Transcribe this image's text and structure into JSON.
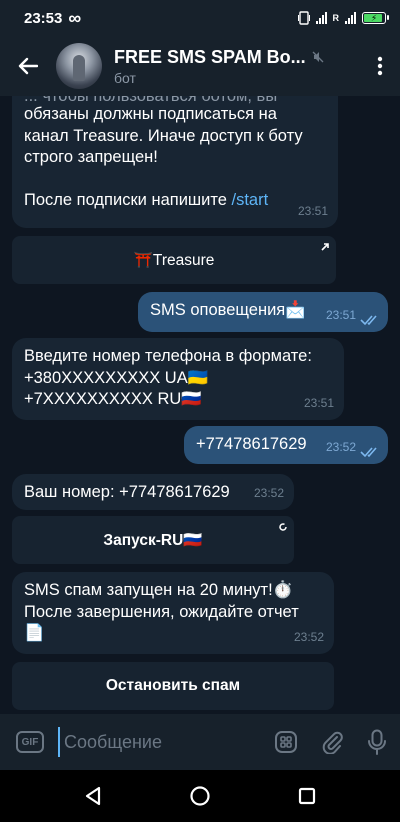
{
  "status": {
    "time": "23:53",
    "infinity": "∞",
    "net_label": "R"
  },
  "header": {
    "title": "FREE SMS SPAM Bo...",
    "subtitle": "бот"
  },
  "messages": [
    {
      "direction": "in",
      "text": "обязаны должны подписаться на канал Treasure. Иначе доступ к боту строго запрещен!",
      "partial_top": "... чтобы пользоваться ботом, вы",
      "text2": "После подписки напишите ",
      "link": "/start",
      "time": "23:51"
    },
    {
      "kind": "inline-button",
      "label": "⛩️Treasure"
    },
    {
      "direction": "out",
      "text": "SMS оповещения📩",
      "time": "23:51"
    },
    {
      "direction": "in",
      "lines": [
        "Введите номер телефона в формате:",
        "+380XXXXXXXXX UA🇺🇦",
        "+7XXXXXXXXXX RU🇷🇺"
      ],
      "time": "23:51"
    },
    {
      "direction": "out",
      "text": "+77478617629",
      "time": "23:52"
    },
    {
      "direction": "in",
      "text": "Ваш номер: +77478617629",
      "time": "23:52"
    },
    {
      "kind": "inline-button",
      "label": "Запуск-RU🇷🇺"
    },
    {
      "direction": "in",
      "lines": [
        "SMS спам запущен на 20 минут!⏱️",
        "После завершения, ожидайте отчет",
        "📄"
      ],
      "time": "23:52"
    },
    {
      "kind": "inline-button",
      "label": "Остановить спам"
    }
  ],
  "input": {
    "placeholder": "Сообщение",
    "gif_label": "GIF"
  },
  "colors": {
    "background": "#0e1621",
    "header": "#17212b",
    "incoming": "#182533",
    "outgoing": "#2b5278",
    "link": "#5eb5f7"
  },
  "icons": [
    "back-arrow-icon",
    "muted-icon",
    "more-vertical-icon",
    "gif-icon",
    "emoji-icon",
    "attach-icon",
    "mic-icon",
    "external-link-icon",
    "loading-icon",
    "read-ticks-icon",
    "nav-back-icon",
    "nav-home-icon",
    "nav-recents-icon"
  ]
}
